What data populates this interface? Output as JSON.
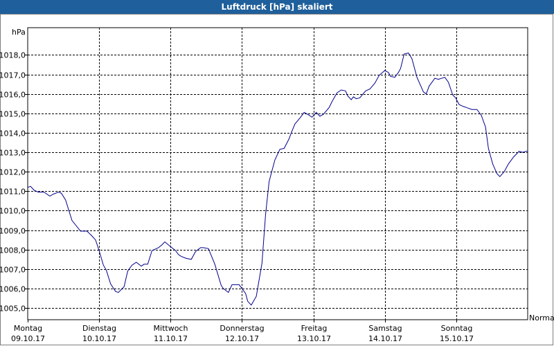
{
  "title": "Luftdruck [hPa] skaliert",
  "chart_data": {
    "type": "line",
    "title": "Luftdruck [hPa] skaliert",
    "ylabel": "hPa",
    "ylim": [
      1004.4,
      1019.4
    ],
    "yticks": [
      "1005,0",
      "1006,0",
      "1007,0",
      "1008,0",
      "1009,0",
      "1010,0",
      "1011,0",
      "1012,0",
      "1013,0",
      "1014,0",
      "1015,0",
      "1016,0",
      "1017,0",
      "1018,0"
    ],
    "ytick_values": [
      1005,
      1006,
      1007,
      1008,
      1009,
      1010,
      1011,
      1012,
      1013,
      1014,
      1015,
      1016,
      1017,
      1018
    ],
    "xlim": [
      0,
      7
    ],
    "days": [
      {
        "weekday": "Montag",
        "date": "09.10.17"
      },
      {
        "weekday": "Dienstag",
        "date": "10.10.17"
      },
      {
        "weekday": "Mittwoch",
        "date": "11.10.17"
      },
      {
        "weekday": "Donnerstag",
        "date": "12.10.17"
      },
      {
        "weekday": "Freitag",
        "date": "13.10.17"
      },
      {
        "weekday": "Samstag",
        "date": "14.10.17"
      },
      {
        "weekday": "Sonntag",
        "date": "15.10.17"
      }
    ],
    "x_end_label": "Normal",
    "grid": true,
    "line_color": "#00008b",
    "series": [
      {
        "x": [
          0,
          0.04,
          0.09,
          0.15,
          0.23,
          0.31,
          0.36,
          0.43,
          0.47,
          0.53,
          0.62,
          0.74,
          0.83,
          0.9,
          0.95,
          1.0,
          1.06,
          1.1,
          1.16,
          1.23,
          1.27,
          1.35,
          1.4,
          1.46,
          1.52,
          1.59,
          1.63,
          1.68,
          1.74,
          1.83,
          1.88,
          1.92,
          2.0,
          2.07,
          2.11,
          2.15,
          2.22,
          2.29,
          2.35,
          2.42,
          2.46,
          2.53,
          2.62,
          2.71,
          2.74,
          2.81,
          2.86,
          2.92,
          2.96,
          3.05,
          3.08,
          3.13,
          3.2,
          3.28,
          3.33,
          3.38,
          3.46,
          3.53,
          3.59,
          3.66,
          3.69,
          3.74,
          3.82,
          3.87,
          3.92,
          3.98,
          4.04,
          4.09,
          4.14,
          4.22,
          4.26,
          4.33,
          4.39,
          4.45,
          4.48,
          4.53,
          4.56,
          4.6,
          4.65,
          4.73,
          4.79,
          4.86,
          4.92,
          5.0,
          5.05,
          5.08,
          5.14,
          5.19,
          5.22,
          5.27,
          5.33,
          5.38,
          5.45,
          5.54,
          5.58,
          5.62,
          5.66,
          5.7,
          5.75,
          5.84,
          5.89,
          5.95,
          5.99,
          6.04,
          6.1,
          6.14,
          6.22,
          6.29,
          6.35,
          6.41,
          6.45,
          6.51,
          6.57,
          6.61,
          6.67,
          6.73,
          6.8,
          6.84,
          6.88,
          6.93,
          6.98,
          7.0
        ],
        "y": [
          1011.2,
          1011.25,
          1011.05,
          1010.95,
          1010.95,
          1010.75,
          1010.85,
          1010.95,
          1010.9,
          1010.55,
          1009.5,
          1008.95,
          1008.95,
          1008.7,
          1008.5,
          1007.95,
          1007.2,
          1006.95,
          1006.25,
          1005.85,
          1005.8,
          1006.1,
          1006.9,
          1007.2,
          1007.35,
          1007.15,
          1007.25,
          1007.25,
          1007.95,
          1008.1,
          1008.25,
          1008.4,
          1008.15,
          1007.95,
          1007.75,
          1007.65,
          1007.55,
          1007.5,
          1007.9,
          1008.1,
          1008.1,
          1008.05,
          1007.25,
          1006.15,
          1006.0,
          1005.8,
          1006.2,
          1006.2,
          1006.2,
          1005.75,
          1005.35,
          1005.15,
          1005.6,
          1007.3,
          1009.8,
          1011.5,
          1012.6,
          1013.15,
          1013.2,
          1013.7,
          1014.0,
          1014.45,
          1014.8,
          1015.05,
          1014.95,
          1014.8,
          1015.05,
          1014.85,
          1014.95,
          1015.3,
          1015.6,
          1016.05,
          1016.2,
          1016.15,
          1015.9,
          1015.7,
          1015.85,
          1015.75,
          1015.8,
          1016.15,
          1016.25,
          1016.55,
          1016.95,
          1017.2,
          1017.1,
          1016.9,
          1016.85,
          1017.1,
          1017.3,
          1018.05,
          1018.1,
          1017.8,
          1016.85,
          1016.1,
          1016.0,
          1016.4,
          1016.6,
          1016.8,
          1016.75,
          1016.85,
          1016.6,
          1015.95,
          1015.8,
          1015.45,
          1015.35,
          1015.3,
          1015.2,
          1015.2,
          1014.9,
          1014.3,
          1013.2,
          1012.4,
          1011.9,
          1011.75,
          1012.0,
          1012.4,
          1012.75,
          1012.9,
          1013.05,
          1013.0,
          1013.05,
          1013.05
        ]
      }
    ]
  }
}
